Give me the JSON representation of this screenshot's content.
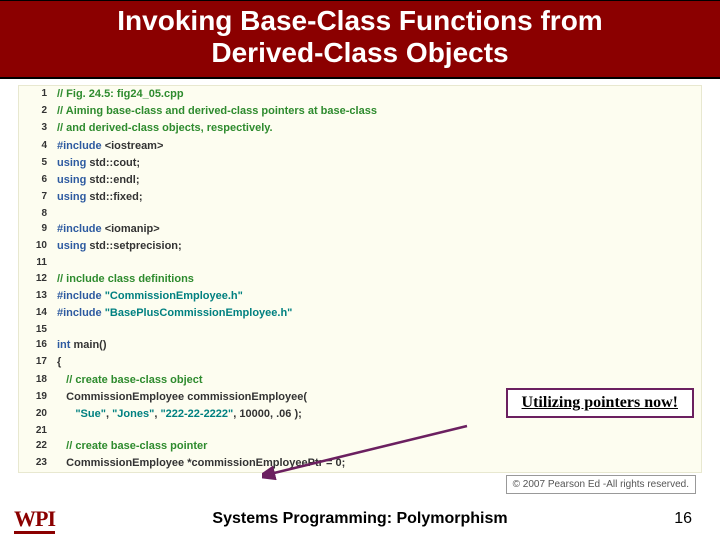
{
  "title": {
    "line1": "Invoking Base-Class Functions from",
    "line2": "Derived-Class Objects"
  },
  "code": [
    {
      "n": "1",
      "tokens": [
        [
          "comment",
          "// Fig. 24.5: fig24_05.cpp"
        ]
      ]
    },
    {
      "n": "2",
      "tokens": [
        [
          "comment",
          "// Aiming base-class and derived-class pointers at base-class"
        ]
      ]
    },
    {
      "n": "3",
      "tokens": [
        [
          "comment",
          "// and derived-class objects, respectively."
        ]
      ]
    },
    {
      "n": "4",
      "tokens": [
        [
          "pre",
          "#include "
        ],
        [
          "plain",
          "<iostream>"
        ]
      ]
    },
    {
      "n": "5",
      "tokens": [
        [
          "kw",
          "using "
        ],
        [
          "plain",
          "std::cout;"
        ]
      ]
    },
    {
      "n": "6",
      "tokens": [
        [
          "kw",
          "using "
        ],
        [
          "plain",
          "std::endl;"
        ]
      ]
    },
    {
      "n": "7",
      "tokens": [
        [
          "kw",
          "using "
        ],
        [
          "plain",
          "std::fixed;"
        ]
      ]
    },
    {
      "n": "8",
      "tokens": [
        [
          "plain",
          ""
        ]
      ]
    },
    {
      "n": "9",
      "tokens": [
        [
          "pre",
          "#include "
        ],
        [
          "plain",
          "<iomanip>"
        ]
      ]
    },
    {
      "n": "10",
      "tokens": [
        [
          "kw",
          "using "
        ],
        [
          "plain",
          "std::setprecision;"
        ]
      ]
    },
    {
      "n": "11",
      "tokens": [
        [
          "plain",
          ""
        ]
      ]
    },
    {
      "n": "12",
      "tokens": [
        [
          "comment",
          "// include class definitions"
        ]
      ]
    },
    {
      "n": "13",
      "tokens": [
        [
          "pre",
          "#include "
        ],
        [
          "str",
          "\"CommissionEmployee.h\""
        ]
      ]
    },
    {
      "n": "14",
      "tokens": [
        [
          "pre",
          "#include "
        ],
        [
          "str",
          "\"BasePlusCommissionEmployee.h\""
        ]
      ]
    },
    {
      "n": "15",
      "tokens": [
        [
          "plain",
          ""
        ]
      ]
    },
    {
      "n": "16",
      "tokens": [
        [
          "kw",
          "int "
        ],
        [
          "plain",
          "main()"
        ]
      ]
    },
    {
      "n": "17",
      "tokens": [
        [
          "plain",
          "{"
        ]
      ]
    },
    {
      "n": "18",
      "tokens": [
        [
          "plain",
          "   "
        ],
        [
          "comment",
          "// create base-class object"
        ]
      ]
    },
    {
      "n": "19",
      "tokens": [
        [
          "plain",
          "   CommissionEmployee commissionEmployee("
        ]
      ]
    },
    {
      "n": "20",
      "tokens": [
        [
          "plain",
          "      "
        ],
        [
          "str",
          "\"Sue\""
        ],
        [
          "plain",
          ", "
        ],
        [
          "str",
          "\"Jones\""
        ],
        [
          "plain",
          ", "
        ],
        [
          "str",
          "\"222-22-2222\""
        ],
        [
          "plain",
          ", "
        ],
        [
          "num",
          "10000"
        ],
        [
          "plain",
          ", "
        ],
        [
          "num",
          ".06"
        ],
        [
          "plain",
          " );"
        ]
      ]
    },
    {
      "n": "21",
      "tokens": [
        [
          "plain",
          ""
        ]
      ]
    },
    {
      "n": "22",
      "tokens": [
        [
          "plain",
          "   "
        ],
        [
          "comment",
          "// create base-class pointer"
        ]
      ]
    },
    {
      "n": "23",
      "tokens": [
        [
          "plain",
          "   CommissionEmployee *commissionEmployeePtr = "
        ],
        [
          "num",
          "0"
        ],
        [
          "plain",
          ";"
        ]
      ]
    }
  ],
  "callout": "Utilizing pointers now!",
  "footer": "Systems Programming:  Polymorphism",
  "page": "16",
  "logo": "WPI",
  "copyright": "© 2007 Pearson Ed -All rights reserved."
}
